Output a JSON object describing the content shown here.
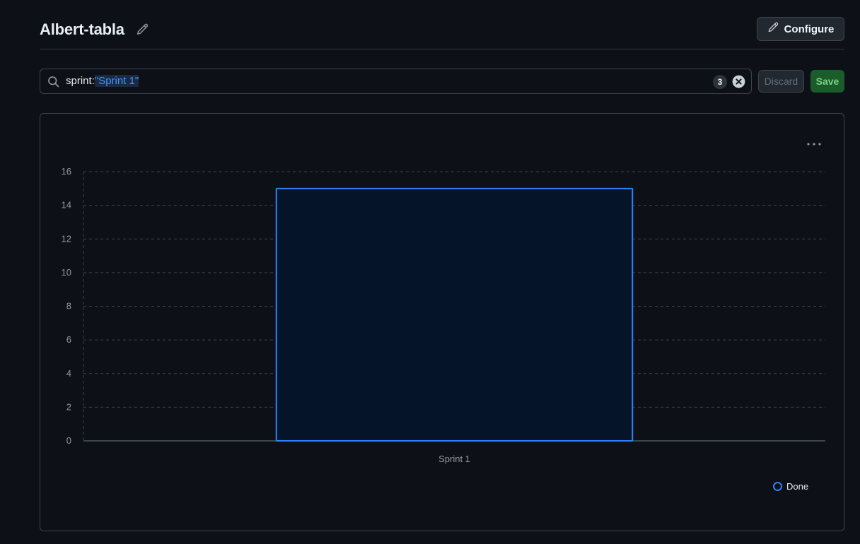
{
  "header": {
    "title": "Albert-tabla",
    "configure_label": "Configure"
  },
  "filter": {
    "query_key": "sprint:",
    "query_value": "\"Sprint 1\"",
    "count": "3"
  },
  "actions": {
    "discard_label": "Discard",
    "save_label": "Save"
  },
  "icons": {
    "title_edit": "pencil-icon",
    "configure": "pencil-icon",
    "search": "search-icon",
    "clear": "x-circle-icon",
    "menu": "kebab-horizontal-icon"
  },
  "colors": {
    "bar_fill": "#051429",
    "bar_stroke": "#2f81f7",
    "save_bg": "#1a5d2a",
    "accent": "#4493f8"
  },
  "chart_data": {
    "type": "bar",
    "categories": [
      "Sprint 1"
    ],
    "series": [
      {
        "name": "Done",
        "values": [
          15
        ]
      }
    ],
    "yticks": [
      "0",
      "2",
      "4",
      "6",
      "8",
      "10",
      "12",
      "14",
      "16"
    ],
    "ylim": [
      0,
      16
    ],
    "grid": true,
    "legend_position": "bottom-right",
    "xlabel": "",
    "ylabel": "",
    "title": ""
  }
}
